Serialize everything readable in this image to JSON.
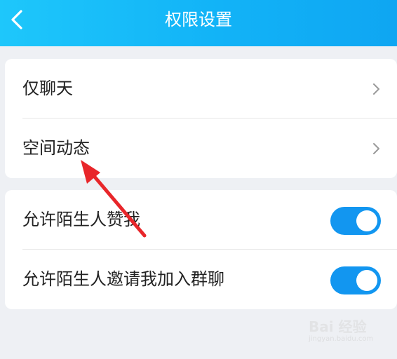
{
  "header": {
    "title": "权限设置",
    "back_icon": "chevron-left-icon",
    "background": "#16b6f8"
  },
  "group1": {
    "items": [
      {
        "label": "仅聊天",
        "icon": "chevron-right-icon"
      },
      {
        "label": "空间动态",
        "icon": "chevron-right-icon"
      }
    ]
  },
  "group2": {
    "items": [
      {
        "label": "允许陌生人赞我",
        "toggle": "on"
      },
      {
        "label": "允许陌生人邀请我加入群聊",
        "toggle": "on"
      }
    ]
  },
  "colors": {
    "toggle_on": "#1296f0",
    "annotation_arrow": "#e8262a"
  },
  "watermark": {
    "logo": "Bai 经验",
    "url": "jingyan.baidu.com"
  }
}
